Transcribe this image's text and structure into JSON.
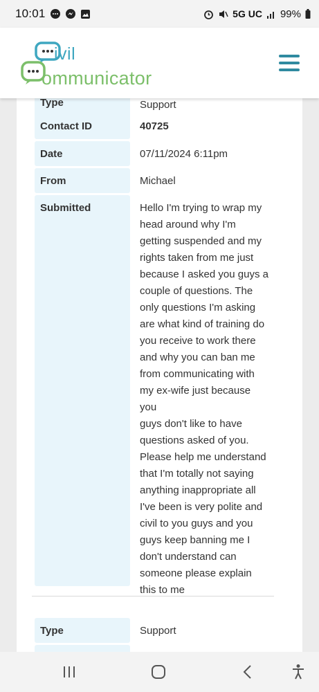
{
  "status_bar": {
    "time": "10:01",
    "network": "5G UC",
    "battery": "99%"
  },
  "header": {
    "logo_line1": "ivil",
    "logo_line2": "ommunicator",
    "brand_colors": {
      "blue": "#3fa7c0",
      "green": "#7cbf6a"
    },
    "menu_icon": "hamburger-icon"
  },
  "message": {
    "type_label": "Type",
    "type_value": "Support",
    "contact_id_label": "Contact ID",
    "contact_id_value": "40725",
    "date_label": "Date",
    "date_value": "07/11/2024 6:11pm",
    "from_label": "From",
    "from_value": "Michael",
    "submitted_label": "Submitted",
    "submitted_lines": [
      "Hello I'm trying to wrap my",
      "head around why I'm",
      "getting suspended and my",
      "rights taken from me just",
      "because I asked you guys a",
      "couple of questions. The",
      "only questions I'm asking",
      "are what kind of training do",
      "you receive to work there",
      "and why you can ban me",
      "from communicating with",
      "my ex-wife just because you",
      "guys don't like to have",
      "questions asked of you.",
      "Please help me understand",
      "that I'm totally not saying",
      "anything inappropriate all",
      "I've been is very polite and",
      "civil to you guys and you",
      "guys keep banning me I",
      "don't understand can",
      "someone please explain",
      "this to me"
    ]
  },
  "next_message": {
    "type_label": "Type",
    "type_value": "Support"
  },
  "nav": {
    "recents": "recents-icon",
    "home": "home-icon",
    "back": "back-icon",
    "accessibility": "accessibility-icon"
  }
}
